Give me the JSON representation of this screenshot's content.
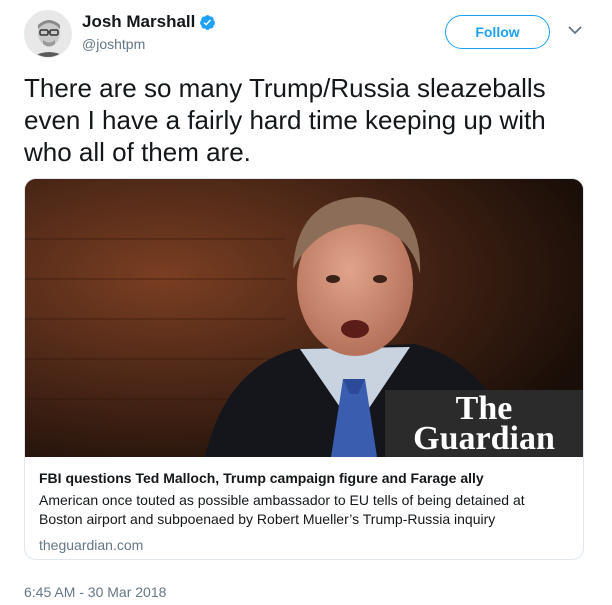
{
  "author": {
    "display_name": "Josh Marshall",
    "handle": "@joshtpm",
    "verified": true,
    "avatar_icon": "user-avatar"
  },
  "actions": {
    "follow_label": "Follow",
    "more_icon": "chevron-down-icon"
  },
  "tweet": {
    "text": "There are so many Trump/Russia sleazeballs even I have a fairly hard time keeping up with who all of them are."
  },
  "card": {
    "brand_logo_line1": "The",
    "brand_logo_line2": "Guardian",
    "title": "FBI questions Ted Malloch, Trump campaign figure and Farage ally",
    "description": "American once touted as possible ambassador to EU tells of being detained at Boston airport and subpoenaed by Robert Mueller’s Trump-Russia inquiry",
    "domain": "theguardian.com"
  },
  "meta": {
    "timestamp": "6:45 AM - 30 Mar 2018"
  },
  "colors": {
    "accent": "#1da1f2",
    "text": "#14171a",
    "secondary_text": "#657786",
    "border": "#e1e8ed"
  }
}
